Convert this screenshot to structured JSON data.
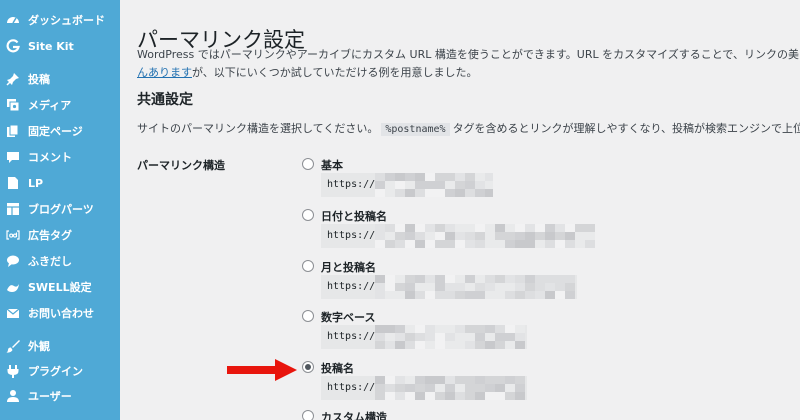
{
  "sidebar": {
    "items": [
      {
        "label": "ダッシュボード",
        "icon": "dashboard-icon"
      },
      {
        "label": "Site Kit",
        "icon": "site-kit-g-icon"
      },
      {
        "label": "投稿",
        "icon": "pin-icon"
      },
      {
        "label": "メディア",
        "icon": "media-icon"
      },
      {
        "label": "固定ページ",
        "icon": "page-icon"
      },
      {
        "label": "コメント",
        "icon": "comment-icon"
      },
      {
        "label": "LP",
        "icon": "lp-page-icon"
      },
      {
        "label": "ブログパーツ",
        "icon": "blog-parts-icon"
      },
      {
        "label": "広告タグ",
        "icon": "ad-tag-icon"
      },
      {
        "label": "ふきだし",
        "icon": "speech-bubble-icon"
      },
      {
        "label": "SWELL設定",
        "icon": "swell-icon"
      },
      {
        "label": "お問い合わせ",
        "icon": "mail-icon"
      },
      {
        "label": "外観",
        "icon": "brush-icon"
      },
      {
        "label": "プラグイン",
        "icon": "plugin-icon"
      },
      {
        "label": "ユーザー",
        "icon": "user-icon"
      }
    ]
  },
  "main": {
    "title": "パーマリンク設定",
    "desc_line1": "WordPress ではパーマリンクやアーカイブにカスタム URL 構造を使うことができます。URL をカスタマイズすることで、リンクの美しさや使いやすさ",
    "desc_link": "んあります",
    "desc_line2_rest": "が、以下にいくつか試していただける例を用意しました。",
    "common_settings_title": "共通設定",
    "common_desc_before": "サイトのパーマリンク構造を選択してください。",
    "common_desc_code": "%postname%",
    "common_desc_after": "タグを含めるとリンクが理解しやすくなり、投稿が検索エンジンで上位に表示されるの",
    "structure_label": "パーマリンク構造",
    "options": [
      {
        "label": "基本",
        "url": "https://"
      },
      {
        "label": "日付と投稿名",
        "url": "https://"
      },
      {
        "label": "月と投稿名",
        "url": "https://"
      },
      {
        "label": "数字ベース",
        "url": "https://"
      },
      {
        "label": "投稿名",
        "url": "https://",
        "checked": true
      },
      {
        "label": "カスタム構造",
        "url": ""
      }
    ]
  },
  "colors": {
    "sidebar_bg": "#4fa9d6",
    "arrow": "#e8150d",
    "link": "#2271b1"
  }
}
